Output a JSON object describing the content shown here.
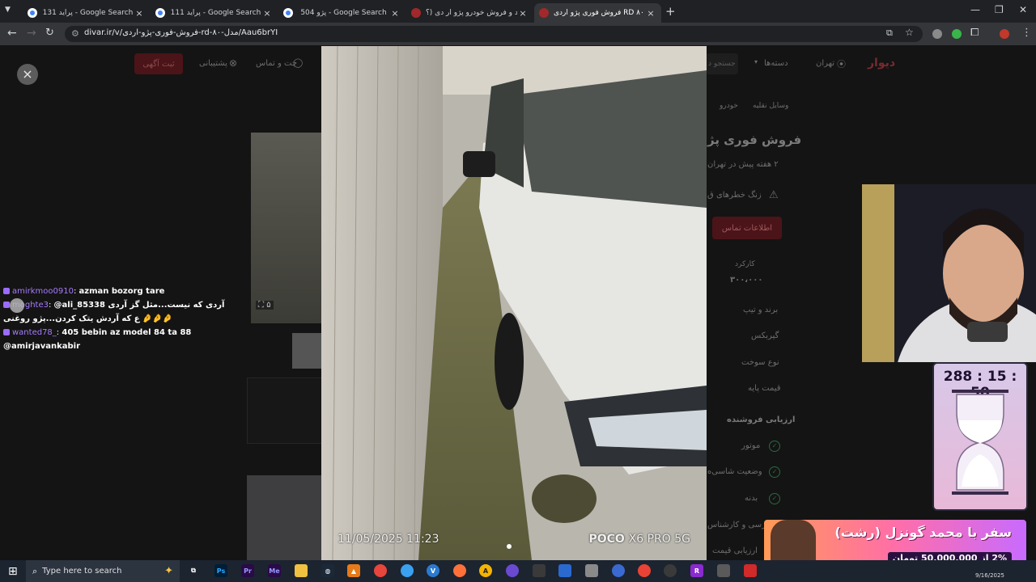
{
  "browser": {
    "tabs": [
      {
        "title": "پراید 131 - Google Search",
        "active": false
      },
      {
        "title": "پراید 111 - Google Search",
        "active": false
      },
      {
        "title": "پژو 504 - Google Search",
        "active": false
      },
      {
        "title": "خرید و فروش خودرو پژو آر دی (؟",
        "active": false
      },
      {
        "title": "فروش فوری پژو اردی RD مدل ۸۰",
        "active": true
      }
    ],
    "url": "divar.ir/v/فروش-فوری-پژو-اردی-rd-مدل-۸۰/Aau6brYI",
    "close_glyph": "×",
    "new_tab_glyph": "+",
    "window_controls": [
      "—",
      "❐",
      "✕"
    ]
  },
  "divar": {
    "logo": "دیوار",
    "city": "تهران",
    "categories": "دسته‌ها",
    "search_placeholder": "جستجو د",
    "post_ad": "ثبت آگهی",
    "support": "پشتیبانی",
    "chat": "چت و تماس",
    "breadcrumb_1": "وسایل نقلیه",
    "breadcrumb_2": "خودرو",
    "ad_title": "فروش فوری پژ",
    "ad_time": "۲ هفته پیش در تهران",
    "warning": "زنگ خطرهای ق",
    "contact_info": "اطلاعات تماس",
    "mileage_label": "کارکرد",
    "mileage_value": "۳۰۰،۰۰۰",
    "specs": [
      "برند و تیپ",
      "گیربکس",
      "نوع سوخت",
      "قیمت پایه"
    ],
    "seller_eval": "ارزیابی فروشنده",
    "eval_items": [
      "موتور",
      "وضعیت شاسی‌ه",
      "بدنه"
    ],
    "eval_more": [
      "بررسی و کارشناس",
      "ارزیابی قیمت"
    ],
    "thumb_count": "۵"
  },
  "lightbox": {
    "close_glyph": "×",
    "photo_date": "11/05/2025  11:23",
    "camera_brand": "POCO",
    "camera_model": "X6 PRO 5G"
  },
  "chat": [
    {
      "user": "amirkmoo0910",
      "message": "azman bozorg tare"
    },
    {
      "user": "moghte3",
      "message": "@ali_85338 آردی که نیست...مثل گز آردی ع که آردش یتک کردن...پژو روغنی"
    },
    {
      "user": "wanted78_",
      "message": "405 bebin az model 84 ta 88 @amirjavankabir"
    }
  ],
  "overlay": {
    "timer": "288 : 15 : 50",
    "banner_title": "سفر با محمد گونزل (رشت)",
    "banner_sub": "2% از 50,000,000 تومان"
  },
  "taskbar": {
    "search_placeholder": "Type here to search",
    "date": "9/16/2025"
  }
}
